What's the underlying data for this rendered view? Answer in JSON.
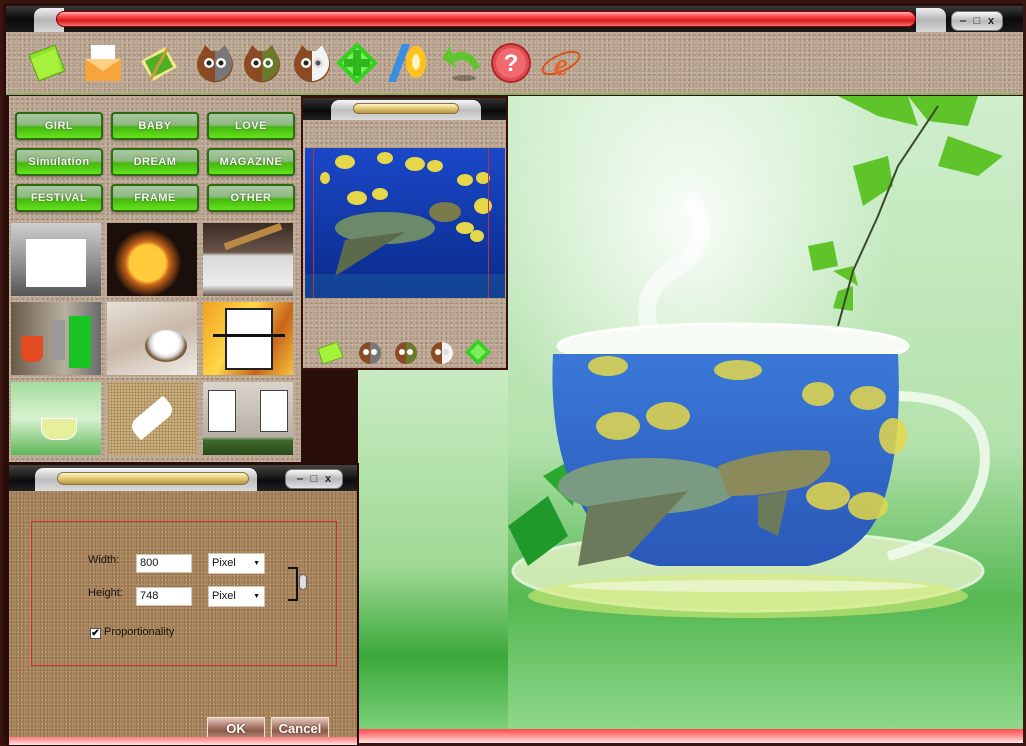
{
  "window": {
    "controls": {
      "minimize": "‒",
      "maximize": "□",
      "close": "x"
    }
  },
  "toolbar": {
    "tools": [
      {
        "name": "open-folder-icon",
        "icon": "folder"
      },
      {
        "name": "envelope-icon",
        "icon": "envelope"
      },
      {
        "name": "edit-photo-icon",
        "icon": "photo-pencil"
      },
      {
        "name": "face-gray-icon",
        "icon": "owl-face-gray"
      },
      {
        "name": "face-green-icon",
        "icon": "owl-face-green"
      },
      {
        "name": "face-white-icon",
        "icon": "owl-face-white"
      },
      {
        "name": "move-arrows-icon",
        "icon": "four-way-arrows"
      },
      {
        "name": "crop-rotate-icon",
        "icon": "ruler-wheel"
      },
      {
        "name": "undo-arrow-icon",
        "icon": "undo"
      },
      {
        "name": "help-icon",
        "icon": "question-mark"
      },
      {
        "name": "internet-explorer-icon",
        "icon": "browser-e"
      }
    ]
  },
  "categories": [
    "GIRL",
    "BABY",
    "LOVE",
    "Simulation",
    "DREAM",
    "MAGAZINE",
    "FESTIVAL",
    "FRAME",
    "OTHER"
  ],
  "templates": [
    {
      "name": "template-blank-city"
    },
    {
      "name": "template-burning-coin"
    },
    {
      "name": "template-glass-cigar"
    },
    {
      "name": "template-colored-drinks"
    },
    {
      "name": "template-coconut-bowl"
    },
    {
      "name": "template-binder-clip"
    },
    {
      "name": "template-green-tea"
    },
    {
      "name": "template-tag-on-sand"
    },
    {
      "name": "template-brick-wall-frames"
    }
  ],
  "preview": {
    "tools": [
      {
        "name": "open-folder-icon"
      },
      {
        "name": "face-gray-icon"
      },
      {
        "name": "face-green-icon"
      },
      {
        "name": "face-white-icon"
      },
      {
        "name": "move-arrows-icon"
      }
    ]
  },
  "dialog": {
    "controls": {
      "minimize": "‒",
      "maximize": "□",
      "close": "x"
    },
    "width_label": "Width:",
    "width_value": "800",
    "height_label": "Height:",
    "height_value": "748",
    "width_unit": "Pixel",
    "height_unit": "Pixel",
    "proportionality_label": "Proportionality",
    "proportionality_checked": true,
    "ok_label": "OK",
    "cancel_label": "Cancel"
  },
  "colors": {
    "title_red": "#e52a2a",
    "category_green": "#4cc014",
    "sand": "#b7a08a",
    "dialog_sand": "#a9865e",
    "group_border": "#c9341e"
  }
}
